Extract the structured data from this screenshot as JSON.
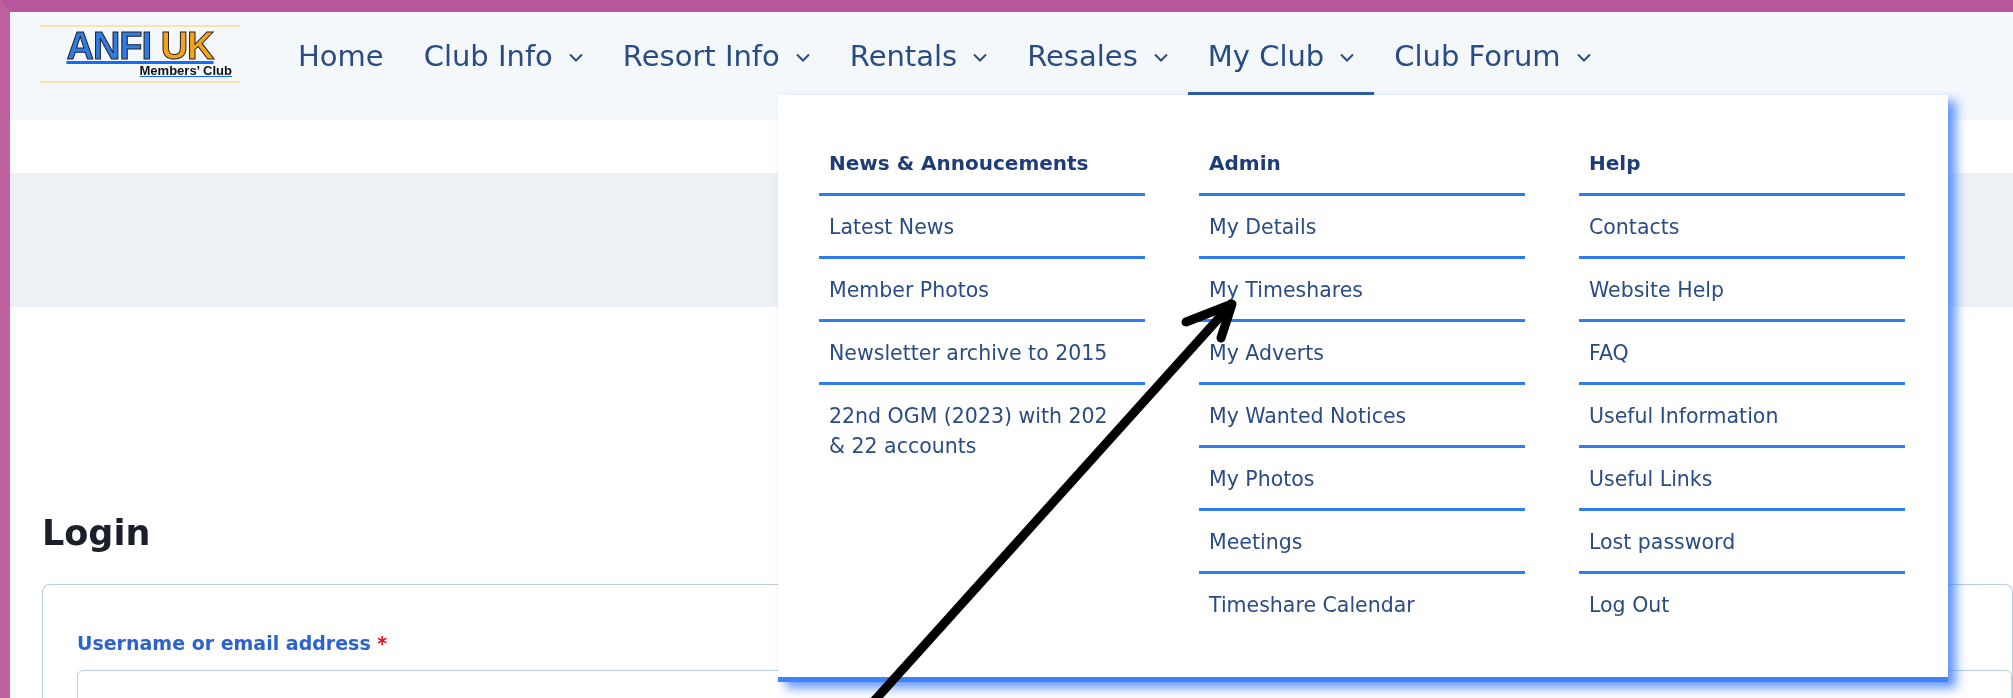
{
  "logo": {
    "title_left": "ANFI",
    "title_right": "UK",
    "subtitle": "Members’ Club"
  },
  "nav": [
    {
      "label": "Home",
      "has_caret": false,
      "selected": false
    },
    {
      "label": "Club Info",
      "has_caret": true,
      "selected": false
    },
    {
      "label": "Resort Info",
      "has_caret": true,
      "selected": false
    },
    {
      "label": "Rentals",
      "has_caret": true,
      "selected": false
    },
    {
      "label": "Resales",
      "has_caret": true,
      "selected": false
    },
    {
      "label": "My Club",
      "has_caret": true,
      "selected": true
    },
    {
      "label": "Club Forum",
      "has_caret": true,
      "selected": false
    }
  ],
  "dropdown": {
    "columns": [
      {
        "heading": "News & Annoucements",
        "items": [
          {
            "lines": [
              "Latest News"
            ]
          },
          {
            "lines": [
              "Member Photos"
            ]
          },
          {
            "lines": [
              "Newsletter archive to 2015"
            ]
          },
          {
            "lines": [
              "22nd OGM (2023) with 202",
              "& 22 accounts"
            ]
          }
        ]
      },
      {
        "heading": "Admin",
        "items": [
          {
            "lines": [
              "My Details"
            ]
          },
          {
            "lines": [
              "My Timeshares"
            ]
          },
          {
            "lines": [
              "My Adverts"
            ]
          },
          {
            "lines": [
              "My Wanted Notices"
            ]
          },
          {
            "lines": [
              "My Photos"
            ]
          },
          {
            "lines": [
              "Meetings"
            ]
          },
          {
            "lines": [
              "Timeshare Calendar"
            ]
          }
        ]
      },
      {
        "heading": "Help",
        "items": [
          {
            "lines": [
              "Contacts"
            ]
          },
          {
            "lines": [
              "Website Help"
            ]
          },
          {
            "lines": [
              "FAQ"
            ]
          },
          {
            "lines": [
              "Useful Information"
            ]
          },
          {
            "lines": [
              "Useful Links"
            ]
          },
          {
            "lines": [
              "Lost password"
            ]
          },
          {
            "lines": [
              "Log Out"
            ]
          }
        ]
      }
    ]
  },
  "login": {
    "title": "Login",
    "username_label": "Username or email address",
    "required_mark": "*"
  }
}
